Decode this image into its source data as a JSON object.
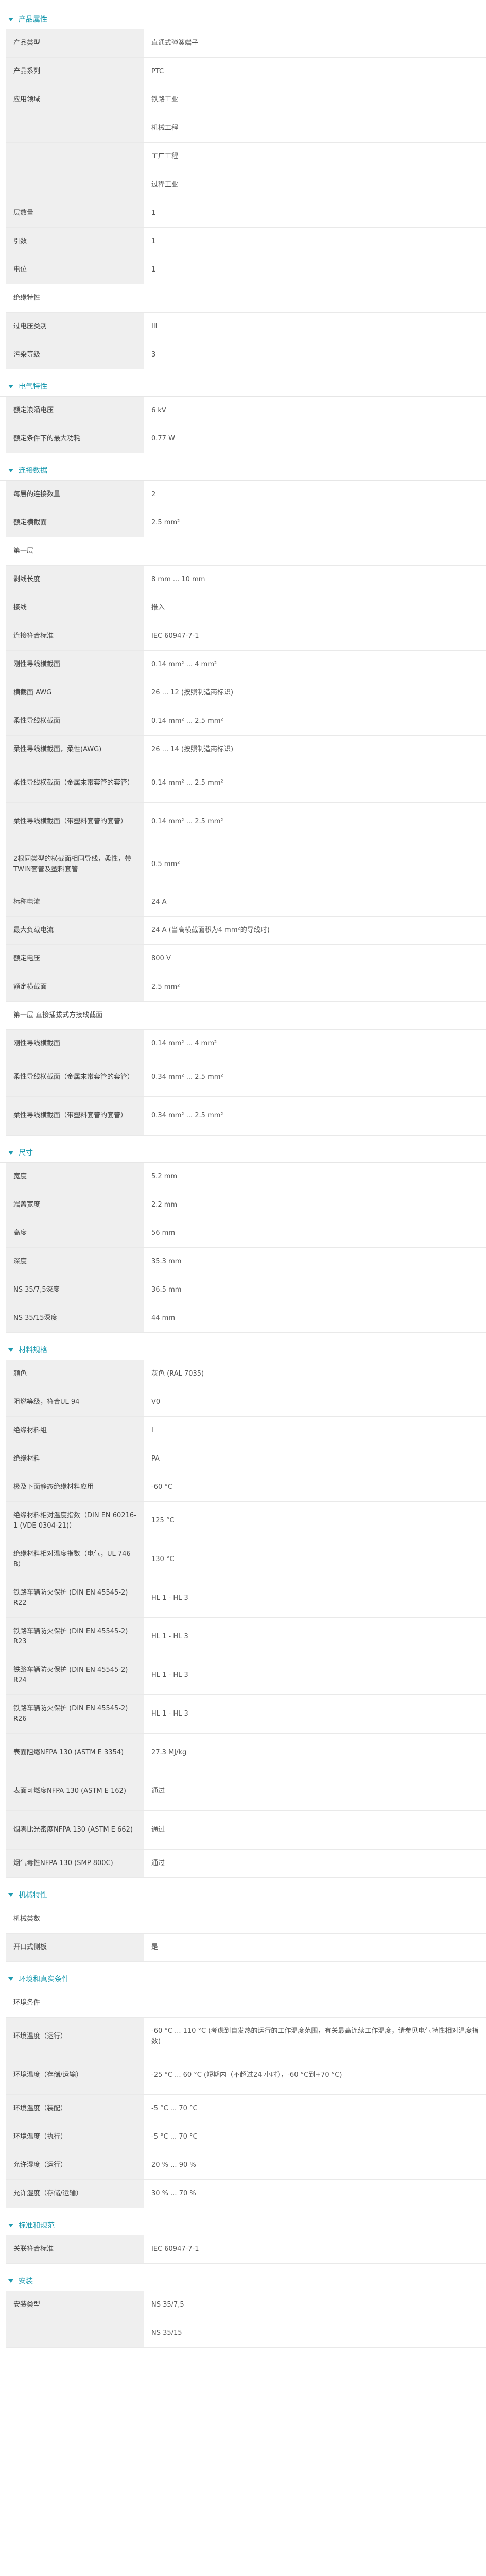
{
  "sections": [
    {
      "title": "产品属性",
      "rows": [
        {
          "k": "产品类型",
          "v": "直通式弹簧端子"
        },
        {
          "k": "产品系列",
          "v": "PTC"
        },
        {
          "k": "应用领域",
          "v": "铁路工业"
        },
        {
          "k": "",
          "v": "机械工程"
        },
        {
          "k": "",
          "v": "工厂工程"
        },
        {
          "k": "",
          "v": "过程工业"
        },
        {
          "k": "层数量",
          "v": "1"
        },
        {
          "k": "引数",
          "v": "1"
        },
        {
          "k": "电位",
          "v": "1"
        },
        {
          "k": "绝缘特性",
          "v": "",
          "sub": true
        },
        {
          "k": "过电压类别",
          "v": "III"
        },
        {
          "k": "污染等级",
          "v": "3"
        }
      ]
    },
    {
      "title": "电气特性",
      "rows": [
        {
          "k": "额定浪涌电压",
          "v": "6 kV"
        },
        {
          "k": "额定条件下的最大功耗",
          "v": "0.77 W"
        }
      ]
    },
    {
      "title": "连接数据",
      "rows": [
        {
          "k": "每层的连接数量",
          "v": "2"
        },
        {
          "k": "额定横截面",
          "v": "2.5 mm²"
        },
        {
          "k": "第一层",
          "v": "",
          "sub": true
        },
        {
          "k": "剥线长度",
          "v": "8 mm ... 10 mm"
        },
        {
          "k": "接线",
          "v": "推入"
        },
        {
          "k": "连接符合标准",
          "v": "IEC 60947-7-1"
        },
        {
          "k": "刚性导线横截面",
          "v": "0.14 mm² ... 4 mm²"
        },
        {
          "k": "横截面 AWG",
          "v": "26 ... 12 (按照制造商标识)"
        },
        {
          "k": "柔性导线横截面",
          "v": "0.14 mm² ... 2.5 mm²"
        },
        {
          "k": "柔性导线横截面，柔性(AWG)",
          "v": "26 ... 14 (按照制造商标识)"
        },
        {
          "k": "柔性导线横截面（金属末带套管的套管）",
          "v": "0.14 mm² ... 2.5 mm²",
          "h": 2
        },
        {
          "k": "柔性导线横截面（带塑料套管的套管）",
          "v": "0.14 mm² ... 2.5 mm²",
          "h": 2
        },
        {
          "k": "2根同类型的横截面相同导线，柔性，带TWIN套管及塑料套管",
          "v": "0.5 mm²",
          "h": 3
        },
        {
          "k": "标称电流",
          "v": "24 A"
        },
        {
          "k": "最大负载电流",
          "v": "24 A (当高横截面积为4 mm²的导线时)"
        },
        {
          "k": "额定电压",
          "v": "800 V"
        },
        {
          "k": "额定横截面",
          "v": "2.5 mm²"
        },
        {
          "k": "第一层 直接插拔式方接线截面",
          "v": "",
          "sub": true
        },
        {
          "k": "刚性导线横截面",
          "v": "0.14 mm² ... 4 mm²"
        },
        {
          "k": "柔性导线横截面（金属末带套管的套管）",
          "v": "0.34 mm² ... 2.5 mm²",
          "h": 2
        },
        {
          "k": "柔性导线横截面（带塑料套管的套管）",
          "v": "0.34 mm² ... 2.5 mm²",
          "h": 2
        }
      ]
    },
    {
      "title": "尺寸",
      "rows": [
        {
          "k": "宽度",
          "v": "5.2 mm"
        },
        {
          "k": "端盖宽度",
          "v": "2.2 mm"
        },
        {
          "k": "高度",
          "v": "56 mm"
        },
        {
          "k": "深度",
          "v": "35.3 mm"
        },
        {
          "k": "NS 35/7,5深度",
          "v": "36.5 mm"
        },
        {
          "k": "NS 35/15深度",
          "v": "44 mm"
        }
      ]
    },
    {
      "title": "材料规格",
      "rows": [
        {
          "k": "颜色",
          "v": "灰色 (RAL 7035)"
        },
        {
          "k": "阻燃等级，符合UL 94",
          "v": "V0"
        },
        {
          "k": "绝缘材料组",
          "v": "I"
        },
        {
          "k": "绝缘材料",
          "v": "PA"
        },
        {
          "k": "极及下面静态绝缘材料应用",
          "v": "-60 °C"
        },
        {
          "k": "绝缘材料相对温度指数（DIN EN 60216-1 (VDE 0304-21)）",
          "v": "125 °C",
          "h": 2
        },
        {
          "k": "绝缘材料相对温度指数（电气，UL 746 B）",
          "v": "130 °C",
          "h": 2
        },
        {
          "k": "铁路车辆防火保护 (DIN EN 45545-2) R22",
          "v": "HL 1 - HL 3",
          "h": 2
        },
        {
          "k": "铁路车辆防火保护 (DIN EN 45545-2) R23",
          "v": "HL 1 - HL 3",
          "h": 2
        },
        {
          "k": "铁路车辆防火保护 (DIN EN 45545-2) R24",
          "v": "HL 1 - HL 3",
          "h": 2
        },
        {
          "k": "铁路车辆防火保护 (DIN EN 45545-2) R26",
          "v": "HL 1 - HL 3",
          "h": 2
        },
        {
          "k": "表面阻燃NFPA 130 (ASTM E 3354)",
          "v": "27.3 MJ/kg",
          "h": 2
        },
        {
          "k": "表面可燃度NFPA 130 (ASTM E 162)",
          "v": "通过",
          "h": 2
        },
        {
          "k": "烟雾比光密度NFPA 130 (ASTM E 662)",
          "v": "通过",
          "h": 2
        },
        {
          "k": "烟气毒性NFPA 130 (SMP 800C)",
          "v": "通过"
        }
      ]
    },
    {
      "title": "机械特性",
      "rows": [
        {
          "k": "机械类数",
          "v": "",
          "sub": true
        },
        {
          "k": "开口式侧板",
          "v": "是"
        }
      ]
    },
    {
      "title": "环境和真实条件",
      "rows": [
        {
          "k": "环境条件",
          "v": "",
          "sub": true
        },
        {
          "k": "环境温度（运行）",
          "v": "-60 °C ... 110 °C (考虑到自发热的运行的工作温度范围，有关最高连续工作温度，请参见电气特性相对温度指数)",
          "h": 2
        },
        {
          "k": "环境温度（存储/运输）",
          "v": "-25 °C ... 60 °C (短期内（不超过24 小时），-60 °C到+70 °C)",
          "h": 2
        },
        {
          "k": "环境温度（装配）",
          "v": "-5 °C ... 70 °C"
        },
        {
          "k": "环境温度（执行）",
          "v": "-5 °C ... 70 °C"
        },
        {
          "k": "允许湿度（运行）",
          "v": "20 % ... 90 %"
        },
        {
          "k": "允许湿度（存储/运输）",
          "v": "30 % ... 70 %"
        }
      ]
    },
    {
      "title": "标准和规范",
      "rows": [
        {
          "k": "关联符合标准",
          "v": "IEC 60947-7-1"
        }
      ]
    },
    {
      "title": "安装",
      "rows": [
        {
          "k": "安装类型",
          "v": "NS 35/7,5"
        },
        {
          "k": "",
          "v": "NS 35/15"
        }
      ]
    }
  ]
}
